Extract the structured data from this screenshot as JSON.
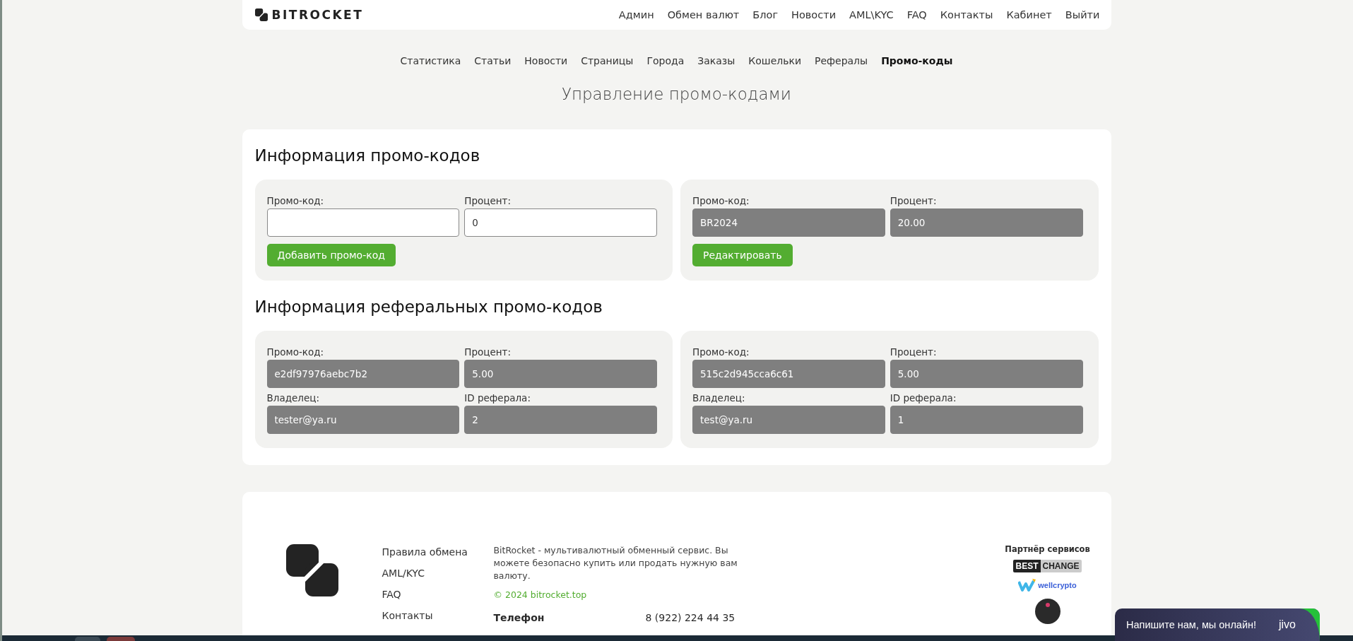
{
  "header": {
    "logo": "BITROCKET",
    "nav": [
      "Админ",
      "Обмен валют",
      "Блог",
      "Новости",
      "AML\\KYC",
      "FAQ",
      "Контакты",
      "Кабинет",
      "Выйти"
    ]
  },
  "admin_nav": [
    {
      "label": "Статистика",
      "selected": false
    },
    {
      "label": "Статьи",
      "selected": false
    },
    {
      "label": "Новости",
      "selected": false
    },
    {
      "label": "Страницы",
      "selected": false
    },
    {
      "label": "Города",
      "selected": false
    },
    {
      "label": "Заказы",
      "selected": false
    },
    {
      "label": "Кошельки",
      "selected": false
    },
    {
      "label": "Рефералы",
      "selected": false
    },
    {
      "label": "Промо-коды",
      "selected": true
    }
  ],
  "page_title": "Управление промо-кодами",
  "sections": [
    {
      "title": "Информация промо-кодов",
      "cards": [
        {
          "fields": [
            {
              "label": "Промо-код:",
              "disabled": false
            },
            {
              "label": "Процент:",
              "value": "0",
              "disabled": false
            }
          ],
          "button": "Добавить промо-код"
        },
        {
          "fields": [
            {
              "label": "Промо-код:",
              "value": "BR2024",
              "disabled": true
            },
            {
              "label": "Процент:",
              "value": "20.00",
              "disabled": true
            }
          ],
          "button": "Редактировать"
        }
      ]
    },
    {
      "title": "Информация реферальных промо-кодов",
      "cards": [
        {
          "fields": [
            {
              "label": "Промо-код:",
              "value": "e2df97976aebc7b2",
              "disabled": true
            },
            {
              "label": "Процент:",
              "value": "5.00",
              "disabled": true
            },
            {
              "label": "Владелец:",
              "value": "tester@ya.ru",
              "disabled": true
            },
            {
              "label": "ID реферала:",
              "value": "2",
              "disabled": true
            }
          ]
        },
        {
          "fields": [
            {
              "label": "Промо-код:",
              "value": "515c2d945cca6c61",
              "disabled": true
            },
            {
              "label": "Процент:",
              "value": "5.00",
              "disabled": true
            },
            {
              "label": "Владелец:",
              "value": "test@ya.ru",
              "disabled": true
            },
            {
              "label": "ID реферала:",
              "value": "1",
              "disabled": true
            }
          ]
        }
      ]
    }
  ],
  "footer": {
    "links": [
      "Правила обмена",
      "AML/KYC",
      "FAQ",
      "Контакты"
    ],
    "description": "BitRocket - мультивалютный обменный сервис. Вы можете безопасно купить или продать нужную вам валюту.",
    "copyright": "© 2024 bitrocket.top",
    "contacts": [
      {
        "label": "Телефон",
        "value": "8 (922) 224 44 35"
      }
    ],
    "partners": {
      "title": "Партнёр сервисов",
      "logos": [
        {
          "kind": "bestchange",
          "parts": [
            "BEST",
            "CHANGE"
          ]
        },
        {
          "kind": "wellcrypto",
          "text": "wellcrypto"
        },
        {
          "kind": "badge"
        }
      ]
    }
  },
  "chat": {
    "text": "Напишите нам, мы онлайн!",
    "brand": "jivo"
  }
}
